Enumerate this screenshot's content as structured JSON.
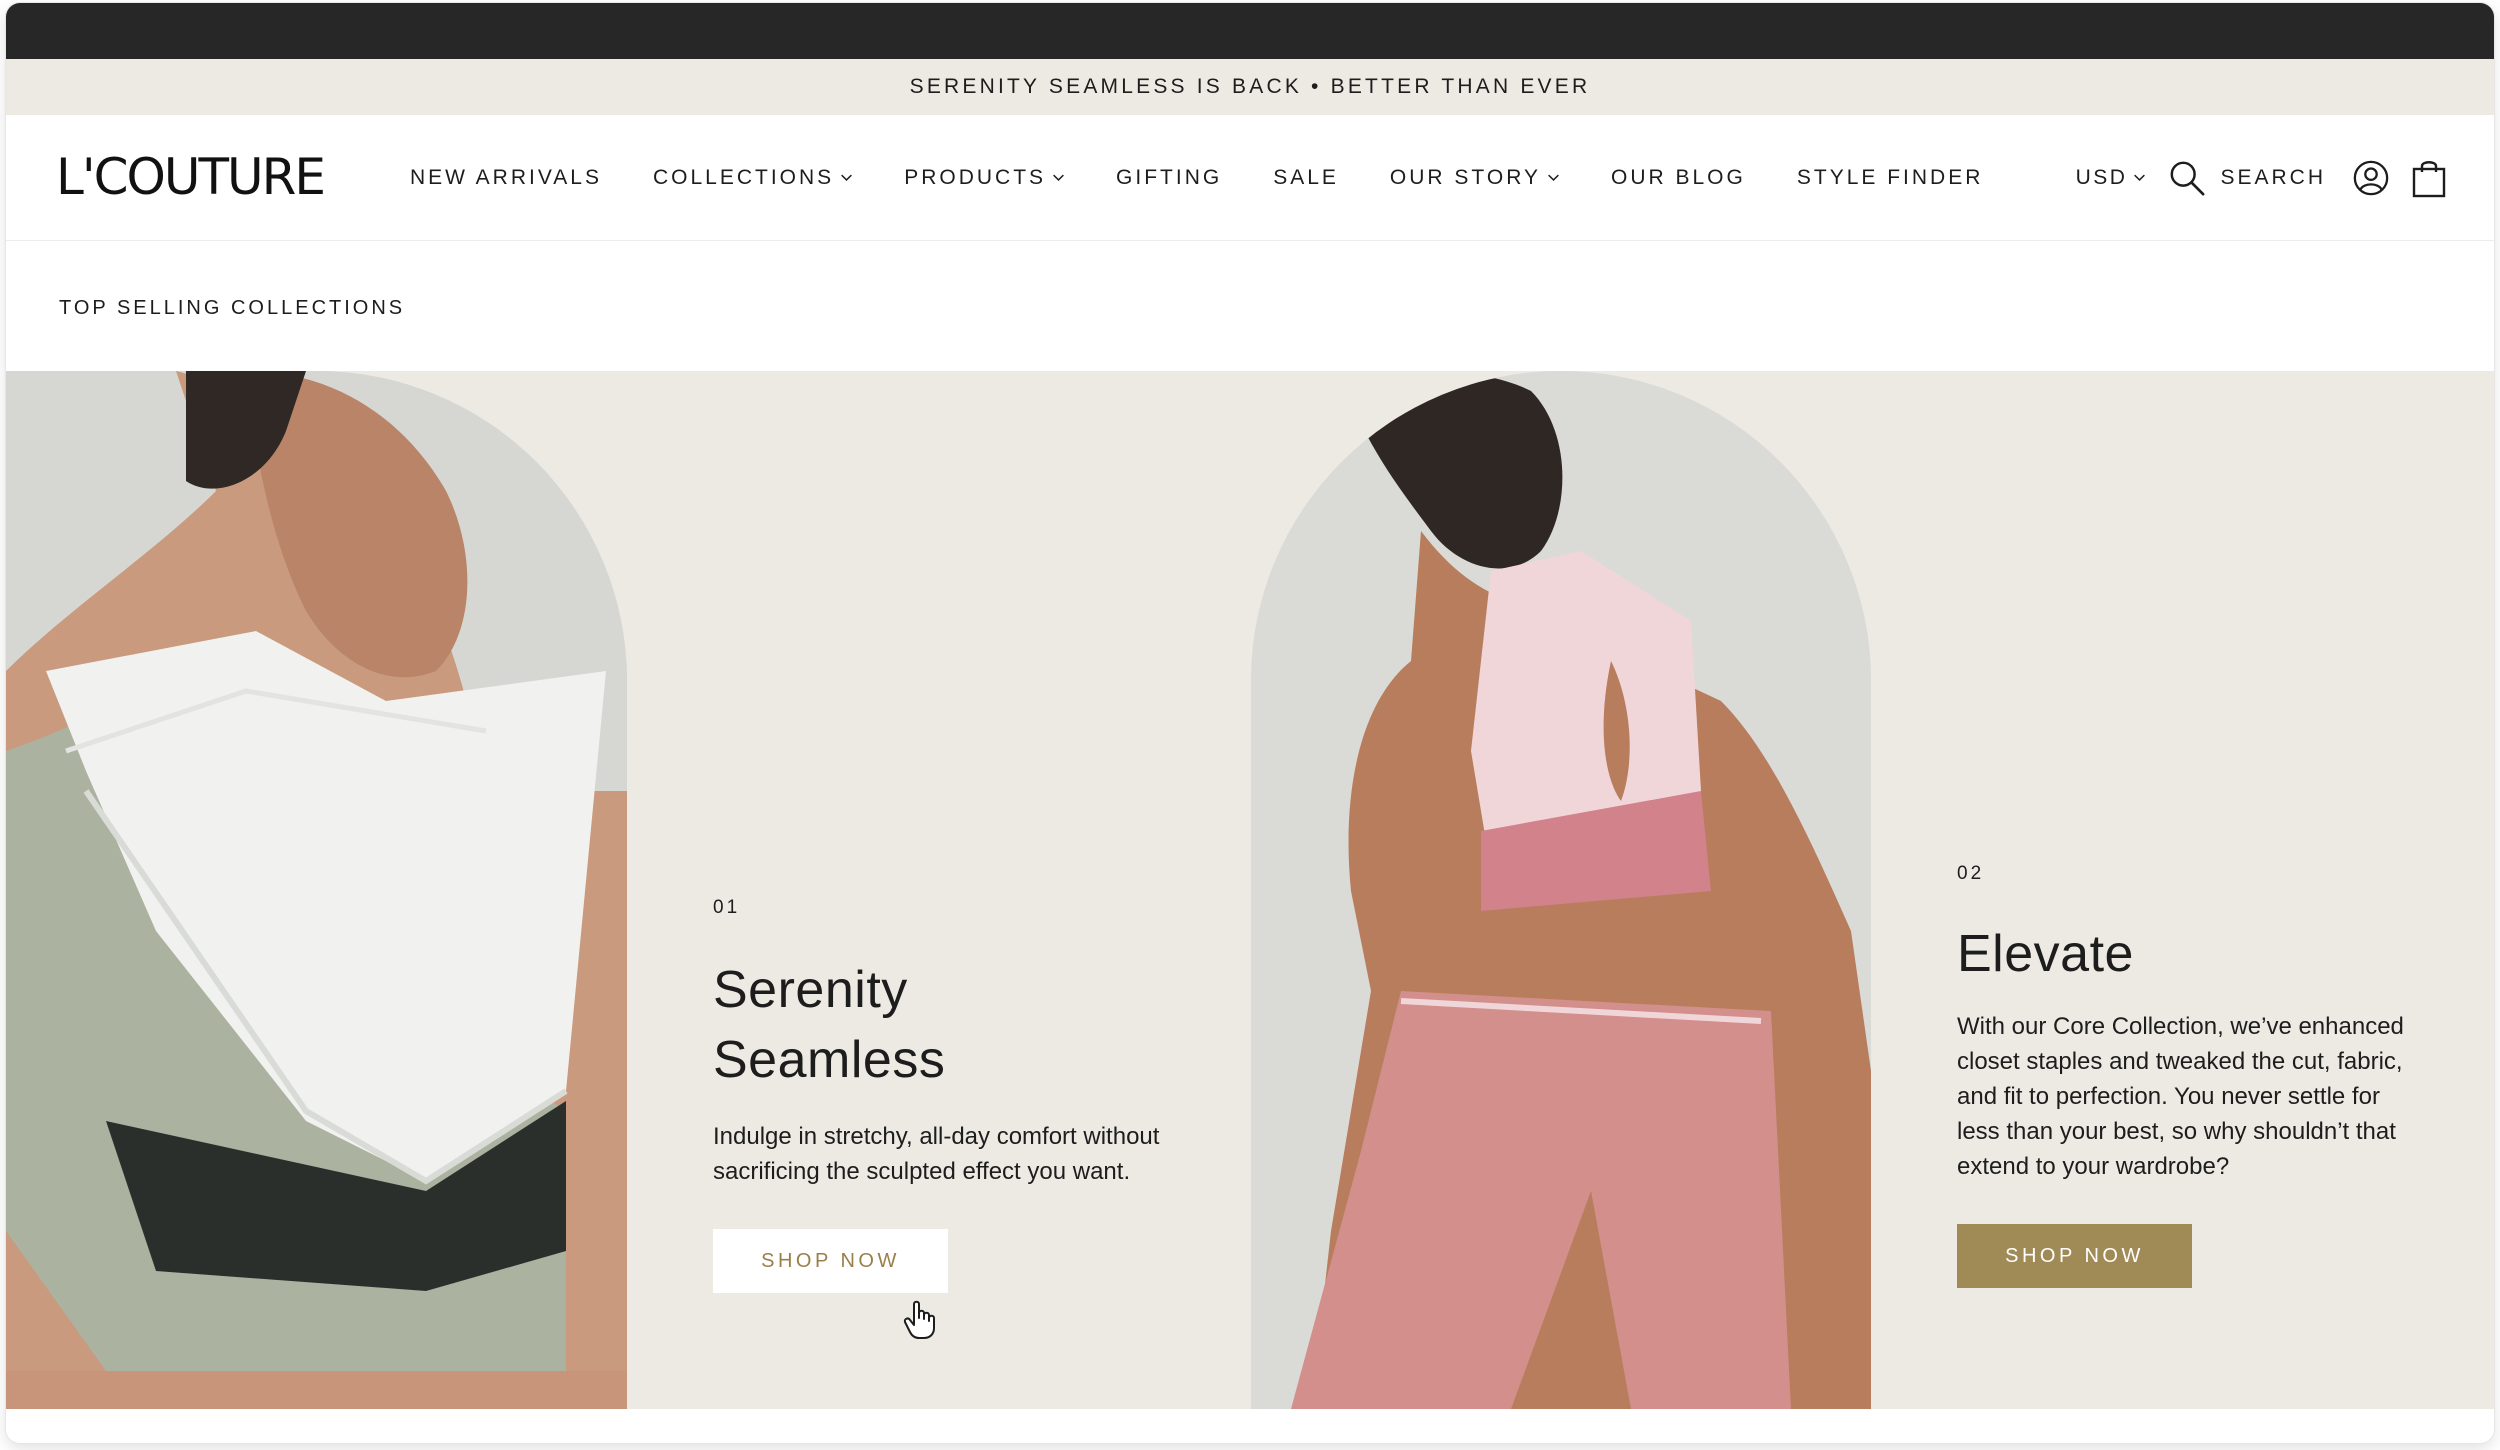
{
  "announcement": "SERENITY SEAMLESS IS BACK • BETTER THAN EVER",
  "brand": {
    "logo": "L'COUTURE"
  },
  "nav": {
    "items": [
      {
        "label": "NEW ARRIVALS",
        "dropdown": false
      },
      {
        "label": "COLLECTIONS",
        "dropdown": true
      },
      {
        "label": "PRODUCTS",
        "dropdown": true
      },
      {
        "label": "GIFTING",
        "dropdown": false
      },
      {
        "label": "SALE",
        "dropdown": false
      },
      {
        "label": "OUR STORY",
        "dropdown": true
      },
      {
        "label": "OUR BLOG",
        "dropdown": false
      },
      {
        "label": "STYLE FINDER",
        "dropdown": false
      }
    ]
  },
  "header": {
    "currency": "USD",
    "search_label": "SEARCH",
    "icons": [
      "search-icon",
      "account-icon",
      "shopping-bag-icon"
    ]
  },
  "section": {
    "title": "TOP SELLING COLLECTIONS"
  },
  "collections": [
    {
      "number": "01",
      "title_line1": "Serenity",
      "title_line2": "Seamless",
      "description": "Indulge in stretchy, all-day comfort without sacrificing the sculpted effect you want.",
      "cta": "SHOP NOW"
    },
    {
      "number": "02",
      "title": "Elevate",
      "description": "With our Core Collection, we’ve enhanced closet staples and tweaked the cut, fabric, and fit to perfection. You never settle for less than your best, so why shouldn’t that extend to your wardrobe?",
      "cta": "SHOP NOW"
    }
  ],
  "colors": {
    "chrome": "#272727",
    "announcement_bg": "#edeae4",
    "hero_bg": "#edeae4",
    "accent_gold": "#a08a56",
    "text": "#1d1d1d"
  }
}
